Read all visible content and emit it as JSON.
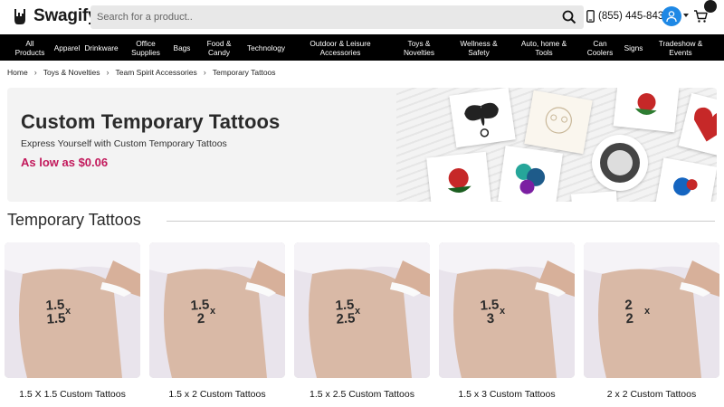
{
  "header": {
    "brand": "Swagify",
    "search_placeholder": "Search for a product..",
    "phone": "(855) 445-8438"
  },
  "nav": {
    "items": [
      "All\nProducts",
      "Apparel",
      "Drinkware",
      "Office\nSupplies",
      "Bags",
      "Food &\nCandy",
      "Technology",
      "Outdoor & Leisure\nAccessories",
      "Toys &\nNovelties",
      "Wellness &\nSafety",
      "Auto, home &\nTools",
      "Can\nCoolers",
      "Signs",
      "Tradeshow &\nEvents"
    ]
  },
  "breadcrumb": {
    "items": [
      "Home",
      "Toys & Novelties",
      "Team Spirit Accessories",
      "Temporary Tattoos"
    ]
  },
  "hero": {
    "title": "Custom Temporary Tattoos",
    "subtitle": "Express Yourself with Custom Temporary Tattoos",
    "price": "As low as $0.06"
  },
  "section": {
    "title": "Temporary Tattoos"
  },
  "products": [
    {
      "name": "1.5 X 1.5 Custom Tattoos",
      "top": "1.5",
      "bottom": "1.5"
    },
    {
      "name": "1.5 x 2 Custom Tattoos",
      "top": "1.5",
      "bottom": "2"
    },
    {
      "name": "1.5 x 2.5 Custom Tattoos",
      "top": "1.5",
      "bottom": "2.5"
    },
    {
      "name": "1.5 x 3 Custom Tattoos",
      "top": "1.5",
      "bottom": "3"
    },
    {
      "name": "2 x 2 Custom Tattoos",
      "top": "2",
      "bottom": "2"
    }
  ],
  "tattoo_x": "x",
  "colors": {
    "price": "#c2185b",
    "nav_bg": "#000000",
    "avatar": "#1e88e5"
  }
}
